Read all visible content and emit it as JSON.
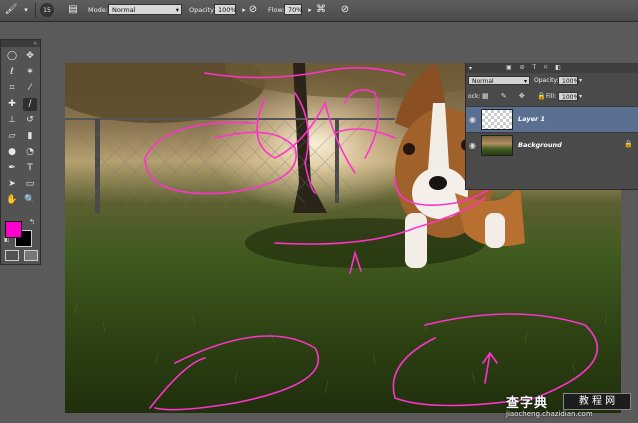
{
  "options_bar": {
    "brush_size": "15",
    "mode_label": "Mode:",
    "mode_value": "Normal",
    "opacity_label": "Opacity:",
    "opacity_value": "100%",
    "flow_label": "Flow:",
    "flow_value": "70%"
  },
  "toolbox": {
    "collapse_glyph": "«",
    "tools": [
      "rect-marquee",
      "move",
      "lasso",
      "magic-wand",
      "crop",
      "eyedropper",
      "healing-brush",
      "brush",
      "clone-stamp",
      "history-brush",
      "eraser",
      "gradient",
      "blur",
      "dodge",
      "pen",
      "type",
      "path-selection",
      "shape",
      "hand",
      "zoom"
    ],
    "foreground_color": "#ff00cc",
    "background_color": "#000000"
  },
  "layers_panel": {
    "blend_mode": "Normal",
    "opacity_label": "Opacity:",
    "opacity_value": "100%",
    "lock_label": "ock:",
    "fill_label": "Fill:",
    "fill_value": "100%",
    "layers": [
      {
        "name": "Layer 1",
        "selected": true
      },
      {
        "name": "Background",
        "selected": false,
        "locked": true
      }
    ]
  },
  "watermark": {
    "main": "查字典",
    "boxed": "教 程 网",
    "url": "jiaocheng.chazidian.com"
  },
  "colors": {
    "accent_selection": "#5b6f92",
    "brush_stroke": "#ff33cc"
  }
}
